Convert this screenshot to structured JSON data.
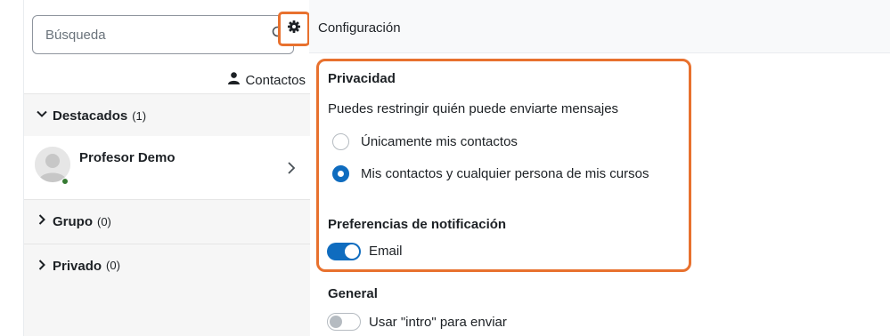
{
  "search": {
    "placeholder": "Búsqueda"
  },
  "icons": {
    "search": "search-icon",
    "gear": "gear-icon",
    "person": "person-icon",
    "chevron_down": "chevron-down-icon",
    "chevron_right": "chevron-right-icon"
  },
  "contacts_link": {
    "label": "Contactos"
  },
  "sections": [
    {
      "label": "Destacados",
      "count": "(1)",
      "expanded": true
    },
    {
      "label": "Grupo",
      "count": "(0)",
      "expanded": false
    },
    {
      "label": "Privado",
      "count": "(0)",
      "expanded": false
    }
  ],
  "starred_contacts": [
    {
      "name": "Profesor Demo",
      "online": true
    }
  ],
  "settings": {
    "header_title": "Configuración",
    "privacy": {
      "title": "Privacidad",
      "description": "Puedes restringir quién puede enviarte mensajes",
      "options": [
        {
          "label": "Únicamente mis contactos",
          "checked": false
        },
        {
          "label": "Mis contactos y cualquier persona de mis cursos",
          "checked": true
        }
      ]
    },
    "notifications": {
      "title": "Preferencias de notificación",
      "email_label": "Email",
      "email_enabled": true
    },
    "general": {
      "title": "General",
      "enter_to_send_label": "Usar \"intro\" para enviar",
      "enter_to_send_enabled": false
    }
  },
  "colors": {
    "highlight": "#e8712e",
    "primary": "#0f6cbf",
    "online": "#357a32"
  }
}
